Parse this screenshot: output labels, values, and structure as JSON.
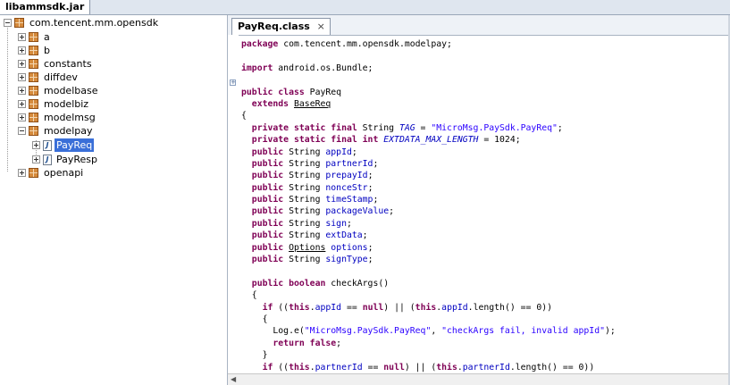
{
  "window": {
    "jar_tab": "libammsdk.jar",
    "editor_tab": "PayReq.class",
    "close_glyph": "×"
  },
  "tree": {
    "root": "com.tencent.mm.opensdk",
    "packages": [
      "a",
      "b",
      "constants",
      "diffdev",
      "modelbase",
      "modelbiz",
      "modelmsg",
      "modelpay"
    ],
    "modelpay_children": [
      "PayReq",
      "PayResp"
    ],
    "last_package": "openapi",
    "selected": "PayReq",
    "java_file_glyph": "J"
  },
  "code_lines": [
    [
      [
        "kw",
        "package"
      ],
      [
        "t",
        " com.tencent.mm.opensdk.modelpay;"
      ]
    ],
    [],
    [
      [
        "kw",
        "import"
      ],
      [
        "t",
        " android.os.Bundle;"
      ]
    ],
    [],
    [
      [
        "kw",
        "public class"
      ],
      [
        "t",
        " PayReq"
      ]
    ],
    [
      [
        "t",
        "  "
      ],
      [
        "kw",
        "extends"
      ],
      [
        "t",
        " "
      ],
      [
        "ul",
        "BaseReq"
      ]
    ],
    [
      [
        "t",
        "{"
      ]
    ],
    [
      [
        "t",
        "  "
      ],
      [
        "kw",
        "private static final"
      ],
      [
        "t",
        " String "
      ],
      [
        "sfld",
        "TAG"
      ],
      [
        "t",
        " = "
      ],
      [
        "str",
        "\"MicroMsg.PaySdk.PayReq\""
      ],
      [
        "t",
        ";"
      ]
    ],
    [
      [
        "t",
        "  "
      ],
      [
        "kw",
        "private static final int"
      ],
      [
        "t",
        " "
      ],
      [
        "sfld",
        "EXTDATA_MAX_LENGTH"
      ],
      [
        "t",
        " = 1024;"
      ]
    ],
    [
      [
        "t",
        "  "
      ],
      [
        "kw",
        "public"
      ],
      [
        "t",
        " String "
      ],
      [
        "fld",
        "appId"
      ],
      [
        "t",
        ";"
      ]
    ],
    [
      [
        "t",
        "  "
      ],
      [
        "kw",
        "public"
      ],
      [
        "t",
        " String "
      ],
      [
        "fld",
        "partnerId"
      ],
      [
        "t",
        ";"
      ]
    ],
    [
      [
        "t",
        "  "
      ],
      [
        "kw",
        "public"
      ],
      [
        "t",
        " String "
      ],
      [
        "fld",
        "prepayId"
      ],
      [
        "t",
        ";"
      ]
    ],
    [
      [
        "t",
        "  "
      ],
      [
        "kw",
        "public"
      ],
      [
        "t",
        " String "
      ],
      [
        "fld",
        "nonceStr"
      ],
      [
        "t",
        ";"
      ]
    ],
    [
      [
        "t",
        "  "
      ],
      [
        "kw",
        "public"
      ],
      [
        "t",
        " String "
      ],
      [
        "fld",
        "timeStamp"
      ],
      [
        "t",
        ";"
      ]
    ],
    [
      [
        "t",
        "  "
      ],
      [
        "kw",
        "public"
      ],
      [
        "t",
        " String "
      ],
      [
        "fld",
        "packageValue"
      ],
      [
        "t",
        ";"
      ]
    ],
    [
      [
        "t",
        "  "
      ],
      [
        "kw",
        "public"
      ],
      [
        "t",
        " String "
      ],
      [
        "fld",
        "sign"
      ],
      [
        "t",
        ";"
      ]
    ],
    [
      [
        "t",
        "  "
      ],
      [
        "kw",
        "public"
      ],
      [
        "t",
        " String "
      ],
      [
        "fld",
        "extData"
      ],
      [
        "t",
        ";"
      ]
    ],
    [
      [
        "t",
        "  "
      ],
      [
        "kw",
        "public"
      ],
      [
        "t",
        " "
      ],
      [
        "ul",
        "Options"
      ],
      [
        "t",
        " "
      ],
      [
        "fld",
        "options"
      ],
      [
        "t",
        ";"
      ]
    ],
    [
      [
        "t",
        "  "
      ],
      [
        "kw",
        "public"
      ],
      [
        "t",
        " String "
      ],
      [
        "fld",
        "signType"
      ],
      [
        "t",
        ";"
      ]
    ],
    [],
    [
      [
        "t",
        "  "
      ],
      [
        "kw",
        "public boolean"
      ],
      [
        "t",
        " checkArgs()"
      ]
    ],
    [
      [
        "t",
        "  {"
      ]
    ],
    [
      [
        "t",
        "    "
      ],
      [
        "kw",
        "if"
      ],
      [
        "t",
        " (("
      ],
      [
        "kw",
        "this"
      ],
      [
        "t",
        "."
      ],
      [
        "fld",
        "appId"
      ],
      [
        "t",
        " == "
      ],
      [
        "kw",
        "null"
      ],
      [
        "t",
        ") || ("
      ],
      [
        "kw",
        "this"
      ],
      [
        "t",
        "."
      ],
      [
        "fld",
        "appId"
      ],
      [
        "t",
        ".length() == 0))"
      ]
    ],
    [
      [
        "t",
        "    {"
      ]
    ],
    [
      [
        "t",
        "      Log.e("
      ],
      [
        "str",
        "\"MicroMsg.PaySdk.PayReq\""
      ],
      [
        "t",
        ", "
      ],
      [
        "str",
        "\"checkArgs fail, invalid appId\""
      ],
      [
        "t",
        ");"
      ]
    ],
    [
      [
        "t",
        "      "
      ],
      [
        "kw",
        "return false"
      ],
      [
        "t",
        ";"
      ]
    ],
    [
      [
        "t",
        "    }"
      ]
    ],
    [
      [
        "t",
        "    "
      ],
      [
        "kw",
        "if"
      ],
      [
        "t",
        " (("
      ],
      [
        "kw",
        "this"
      ],
      [
        "t",
        "."
      ],
      [
        "fld",
        "partnerId"
      ],
      [
        "t",
        " == "
      ],
      [
        "kw",
        "null"
      ],
      [
        "t",
        ") || ("
      ],
      [
        "kw",
        "this"
      ],
      [
        "t",
        "."
      ],
      [
        "fld",
        "partnerId"
      ],
      [
        "t",
        ".length() == 0))"
      ]
    ]
  ],
  "colors": {
    "keyword": "#7f0055",
    "string": "#2a00ff",
    "field": "#0000c0",
    "selection": "#3a6fd8"
  },
  "scroll_arrow_left": "◀"
}
